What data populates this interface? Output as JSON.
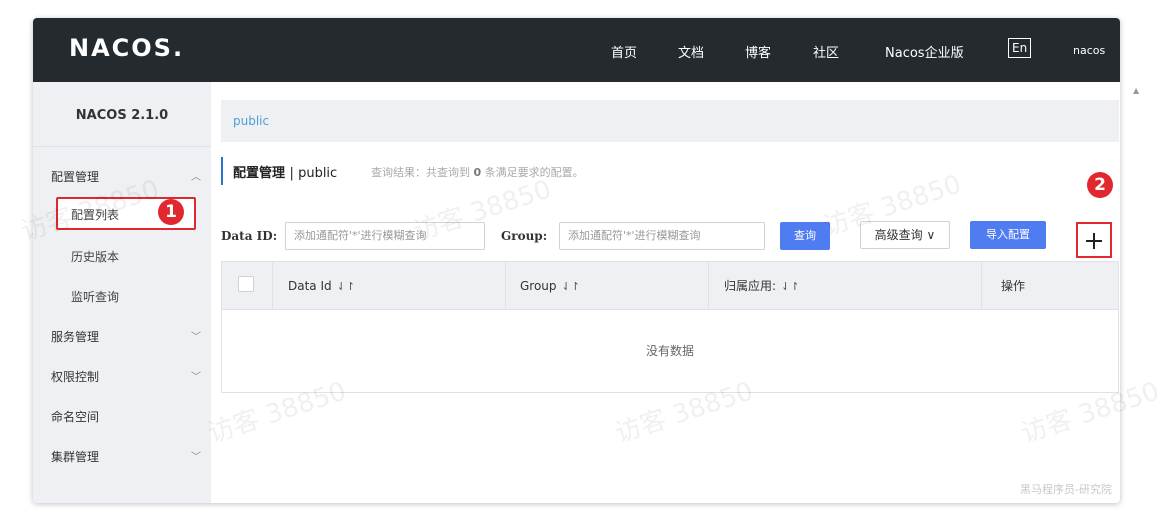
{
  "header": {
    "logo": "NACOS.",
    "nav": [
      "首页",
      "文档",
      "博客",
      "社区",
      "Nacos企业版"
    ],
    "lang": "En",
    "user": "nacos"
  },
  "sidebar": {
    "version": "NACOS 2.1.0",
    "groups": [
      {
        "label": "配置管理",
        "expanded": true,
        "children": [
          "配置列表",
          "历史版本",
          "监听查询"
        ]
      },
      {
        "label": "服务管理",
        "expanded": false
      },
      {
        "label": "权限控制",
        "expanded": false
      },
      {
        "label": "命名空间"
      },
      {
        "label": "集群管理",
        "expanded": false
      }
    ]
  },
  "main": {
    "breadcrumb": "public",
    "title": "配置管理",
    "title_sep": "|",
    "namespace": "public",
    "result_prefix": "查询结果：共查询到",
    "result_count": "0",
    "result_suffix": "条满足要求的配置。",
    "search": {
      "dataid_label": "Data ID:",
      "dataid_placeholder": "添加通配符'*'进行模糊查询",
      "group_label": "Group:",
      "group_placeholder": "添加通配符'*'进行模糊查询",
      "query_button": "查询",
      "advanced_button": "高级查询",
      "import_button": "导入配置"
    },
    "table": {
      "columns": [
        "Data Id",
        "Group",
        "归属应用:",
        "操作"
      ],
      "empty_text": "没有数据"
    }
  },
  "annotations": {
    "marker1": "1",
    "marker2": "2"
  },
  "watermark": "访客 38850",
  "corner_watermark": "黑马程序员-研究院",
  "colors": {
    "header_bg": "#252a2f",
    "accent_blue": "#4f7cf0",
    "highlight_red": "#e0282e"
  }
}
